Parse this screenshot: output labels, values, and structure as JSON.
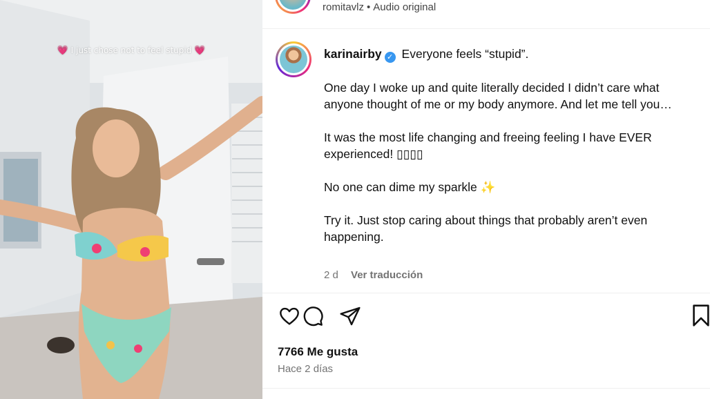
{
  "video": {
    "overlay_text": "I just chose not to feel stupid",
    "overlay_heart": "💗"
  },
  "header": {
    "username": "romitavlz",
    "separator": "•",
    "audio": "Audio original"
  },
  "caption": {
    "username": "karinairby",
    "verified_icon": "✓",
    "lines": [
      "Everyone feels “stupid”.",
      "One day I woke up and quite literally decided I didn’t care what anyone thought of me or my body anymore. And let me tell you…",
      "It was the most life changing and freeing feeling I have EVER experienced! ▯▯▯▯",
      "No one can dime my sparkle ✨",
      "Try it. Just stop caring about things that probably aren’t even happening."
    ],
    "time": "2 d",
    "translate": "Ver traducción"
  },
  "actions": {
    "icons": [
      "heart-icon",
      "comment-icon",
      "share-icon",
      "bookmark-icon"
    ]
  },
  "likes": {
    "text": "7766 Me gusta",
    "ago": "Hace 2 días"
  },
  "colors": {
    "verified": "#3897f0",
    "muted": "#737373",
    "divider": "#efefef"
  }
}
